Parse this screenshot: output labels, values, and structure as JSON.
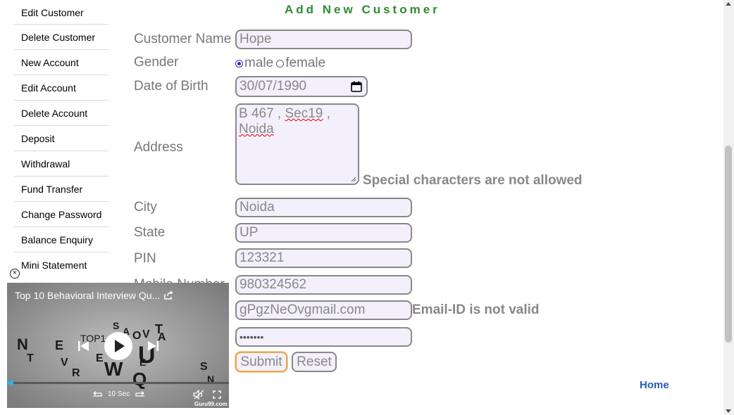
{
  "sidebar": {
    "items": [
      {
        "label": "Edit Customer"
      },
      {
        "label": "Delete Customer"
      },
      {
        "label": "New Account"
      },
      {
        "label": "Edit Account"
      },
      {
        "label": "Delete Account"
      },
      {
        "label": "Deposit"
      },
      {
        "label": "Withdrawal"
      },
      {
        "label": "Fund Transfer"
      },
      {
        "label": "Change Password"
      },
      {
        "label": "Balance Enquiry"
      },
      {
        "label": "Mini Statement"
      }
    ],
    "close_symbol": "×"
  },
  "form": {
    "title": "Add New Customer",
    "customer_name": {
      "label": "Customer Name",
      "value": "Hope"
    },
    "gender": {
      "label": "Gender",
      "options": [
        "male",
        "female"
      ],
      "selected": "male"
    },
    "dob": {
      "label": "Date of Birth",
      "value": "30/07/1990"
    },
    "address": {
      "label": "Address",
      "line1_a": "B 467 , ",
      "line1_b": "Sec19",
      "line1_c": " ,",
      "line2": "Noida",
      "error": "Special characters are not allowed"
    },
    "city": {
      "label": "City",
      "value": "Noida"
    },
    "state": {
      "label": "State",
      "value": "UP"
    },
    "pin": {
      "label": "PIN",
      "value": "123321"
    },
    "mobile": {
      "label": "Mobile Number",
      "value": "980324562"
    },
    "email": {
      "value": "gPgzNeOvgmail.com",
      "error": "Email-ID is not valid"
    },
    "password": {
      "value": "•••••••"
    },
    "submit_label": "Submit",
    "reset_label": "Reset"
  },
  "home_link": "Home",
  "video": {
    "title": "Top 10 Behavioral Interview Qu...",
    "skip_label": "10 Sec",
    "watermark": "Guru99.com",
    "progress": 0.01
  },
  "colors": {
    "title_green": "#2e8b2e",
    "link_blue": "#2a5db0",
    "field_bg": "#f3f0fb",
    "progress_blue": "#2ab3f0"
  }
}
